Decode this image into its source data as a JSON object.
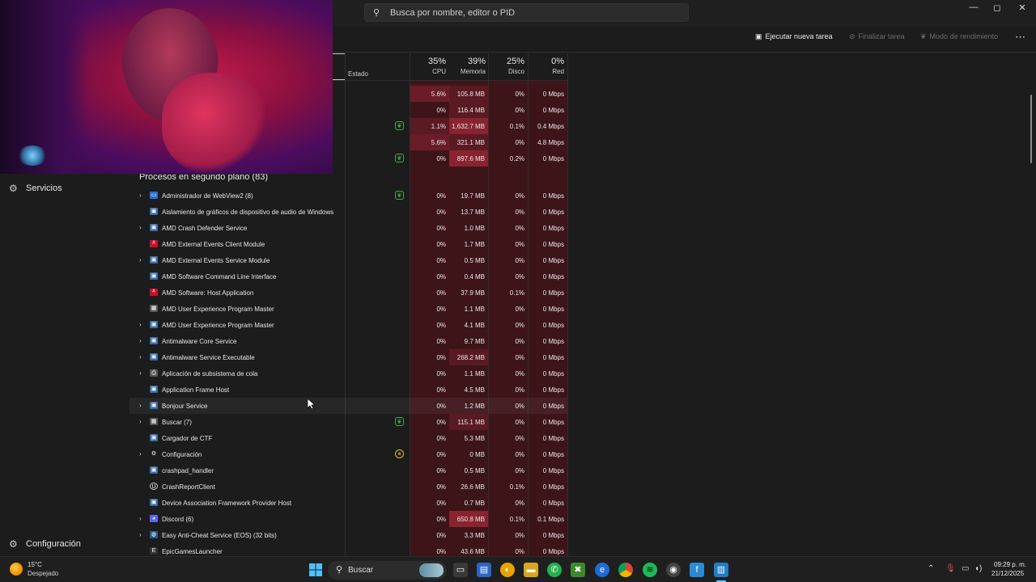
{
  "titlebar": {
    "search_placeholder": "Busca por nombre, editor o PID",
    "minimize": "—",
    "maximize": "◻",
    "close": "✕"
  },
  "sidebar": {
    "services_label": "Servicios",
    "settings_label": "Configuración"
  },
  "toolbar": {
    "run_task": "Ejecutar nueva tarea",
    "end_task": "Finalizar tarea",
    "efficiency_mode": "Modo de rendimiento",
    "more": "⋯"
  },
  "columns": {
    "status": "Estado",
    "cpu": {
      "pct": "35%",
      "label": "CPU"
    },
    "memory": {
      "pct": "39%",
      "label": "Memoria"
    },
    "disk": {
      "pct": "25%",
      "label": "Disco"
    },
    "network": {
      "pct": "0%",
      "label": "Red"
    }
  },
  "apps_rows": [
    {
      "status": "",
      "cpu": "5.6%",
      "mem": "105.8 MB",
      "disk": "0%",
      "net": "0 Mbps"
    },
    {
      "status": "",
      "cpu": "0%",
      "mem": "116.4 MB",
      "disk": "0%",
      "net": "0 Mbps"
    },
    {
      "status": "eco",
      "cpu": "1.1%",
      "mem": "1,632.7 MB",
      "disk": "0.1%",
      "net": "0.4 Mbps"
    },
    {
      "status": "",
      "cpu": "5.6%",
      "mem": "321.1 MB",
      "disk": "0%",
      "net": "4.8 Mbps"
    },
    {
      "status": "eco",
      "cpu": "0%",
      "mem": "897.6 MB",
      "disk": "0.2%",
      "net": "0 Mbps"
    }
  ],
  "section_title": "Procesos en segundo plano (83)",
  "bg_rows": [
    {
      "expand": true,
      "icon": "blue",
      "name": "Administrador de WebView2 (8)",
      "status": "eco",
      "cpu": "0%",
      "mem": "19.7 MB",
      "disk": "0%",
      "net": "0 Mbps"
    },
    {
      "expand": false,
      "icon": "win",
      "name": "Aislamiento de gráficos de dispositivo de audio de Windows",
      "status": "",
      "cpu": "0%",
      "mem": "13.7 MB",
      "disk": "0%",
      "net": "0 Mbps"
    },
    {
      "expand": true,
      "icon": "win",
      "name": "AMD Crash Defender Service",
      "status": "",
      "cpu": "0%",
      "mem": "1.0 MB",
      "disk": "0%",
      "net": "0 Mbps"
    },
    {
      "expand": false,
      "icon": "amd",
      "name": "AMD External Events Client Module",
      "status": "",
      "cpu": "0%",
      "mem": "1.7 MB",
      "disk": "0%",
      "net": "0 Mbps"
    },
    {
      "expand": true,
      "icon": "win",
      "name": "AMD External Events Service Module",
      "status": "",
      "cpu": "0%",
      "mem": "0.5 MB",
      "disk": "0%",
      "net": "0 Mbps"
    },
    {
      "expand": false,
      "icon": "win",
      "name": "AMD Software Command Line Interface",
      "status": "",
      "cpu": "0%",
      "mem": "0.4 MB",
      "disk": "0%",
      "net": "0 Mbps"
    },
    {
      "expand": false,
      "icon": "amd",
      "name": "AMD Software: Host Application",
      "status": "",
      "cpu": "0%",
      "mem": "37.9 MB",
      "disk": "0.1%",
      "net": "0 Mbps"
    },
    {
      "expand": false,
      "icon": "gray",
      "name": "AMD User Experience Program Master",
      "status": "",
      "cpu": "0%",
      "mem": "1.1 MB",
      "disk": "0%",
      "net": "0 Mbps"
    },
    {
      "expand": true,
      "icon": "win",
      "name": "AMD User Experience Program Master",
      "status": "",
      "cpu": "0%",
      "mem": "4.1 MB",
      "disk": "0%",
      "net": "0 Mbps"
    },
    {
      "expand": true,
      "icon": "win",
      "name": "Antimalware Core Service",
      "status": "",
      "cpu": "0%",
      "mem": "9.7 MB",
      "disk": "0%",
      "net": "0 Mbps"
    },
    {
      "expand": true,
      "icon": "win",
      "name": "Antimalware Service Executable",
      "status": "",
      "cpu": "0%",
      "mem": "268.2 MB",
      "disk": "0%",
      "net": "0 Mbps"
    },
    {
      "expand": true,
      "icon": "print",
      "name": "Aplicación de subsistema de cola",
      "status": "",
      "cpu": "0%",
      "mem": "1.1 MB",
      "disk": "0%",
      "net": "0 Mbps"
    },
    {
      "expand": false,
      "icon": "win",
      "name": "Application Frame Host",
      "status": "",
      "cpu": "0%",
      "mem": "4.5 MB",
      "disk": "0%",
      "net": "0 Mbps"
    },
    {
      "expand": true,
      "icon": "win",
      "name": "Bonjour Service",
      "status": "",
      "cpu": "0%",
      "mem": "1.2 MB",
      "disk": "0%",
      "net": "0 Mbps"
    },
    {
      "expand": true,
      "icon": "gray",
      "name": "Buscar (7)",
      "status": "eco",
      "cpu": "0%",
      "mem": "115.1 MB",
      "disk": "0%",
      "net": "0 Mbps"
    },
    {
      "expand": false,
      "icon": "win",
      "name": "Cargador de CTF",
      "status": "",
      "cpu": "0%",
      "mem": "5.3 MB",
      "disk": "0%",
      "net": "0 Mbps"
    },
    {
      "expand": true,
      "icon": "gear",
      "name": "Configuración",
      "status": "pause",
      "cpu": "0%",
      "mem": "0 MB",
      "disk": "0%",
      "net": "0 Mbps"
    },
    {
      "expand": false,
      "icon": "win",
      "name": "crashpad_handler",
      "status": "",
      "cpu": "0%",
      "mem": "0.5 MB",
      "disk": "0%",
      "net": "0 Mbps"
    },
    {
      "expand": false,
      "icon": "ue",
      "name": "CrashReportClient",
      "status": "",
      "cpu": "0%",
      "mem": "26.6 MB",
      "disk": "0.1%",
      "net": "0 Mbps"
    },
    {
      "expand": false,
      "icon": "win",
      "name": "Device Association Framework Provider Host",
      "status": "",
      "cpu": "0%",
      "mem": "0.7 MB",
      "disk": "0%",
      "net": "0 Mbps"
    },
    {
      "expand": true,
      "icon": "discord",
      "name": "Discord (6)",
      "status": "",
      "cpu": "0%",
      "mem": "650.8 MB",
      "disk": "0.1%",
      "net": "0.1 Mbps"
    },
    {
      "expand": true,
      "icon": "eac",
      "name": "Easy Anti-Cheat Service (EOS) (32 bits)",
      "status": "",
      "cpu": "0%",
      "mem": "3.3 MB",
      "disk": "0%",
      "net": "0 Mbps"
    },
    {
      "expand": false,
      "icon": "epic",
      "name": "EpicGamesLauncher",
      "status": "",
      "cpu": "0%",
      "mem": "43.6 MB",
      "disk": "0%",
      "net": "0 Mbps"
    }
  ],
  "taskbar": {
    "temp": "15°C",
    "weather": "Despejado",
    "search": "Buscar",
    "time": "09:29 p. m.",
    "date": "21/12/2025"
  },
  "colors": {
    "heat_low": "#3d1519",
    "heat_mid": "#5a1a22",
    "heat_high": "#7a1f2a",
    "accent": "#60cdff"
  }
}
